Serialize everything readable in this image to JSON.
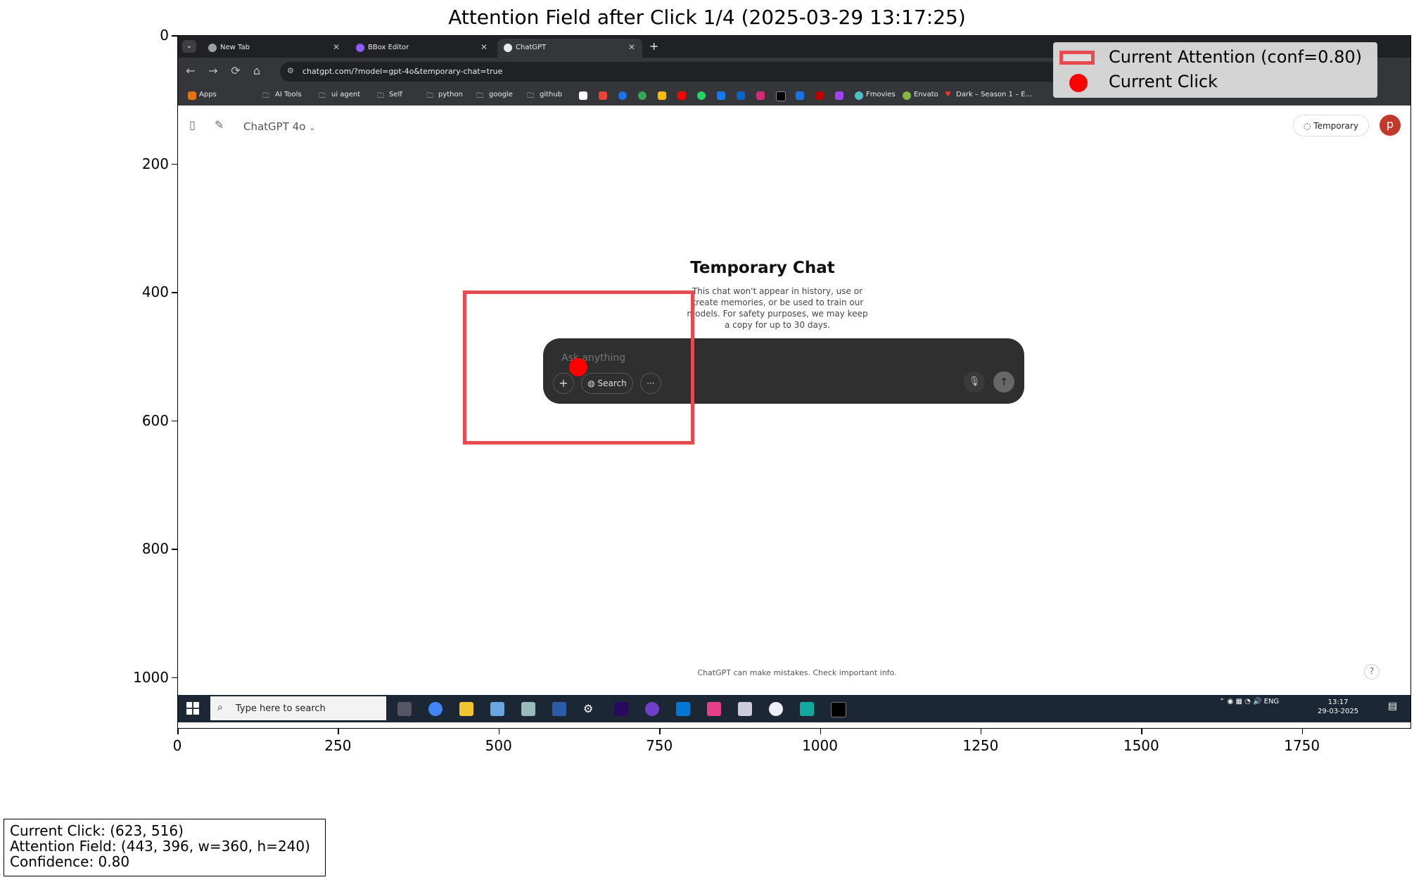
{
  "figure": {
    "title": "Attention Field after Click 1/4 (2025-03-29 13:17:25)",
    "y_ticks": [
      "0",
      "200",
      "400",
      "600",
      "800",
      "1000"
    ],
    "x_ticks": [
      "0",
      "250",
      "500",
      "750",
      "1000",
      "1250",
      "1500",
      "1750"
    ],
    "attention": {
      "x": 443,
      "y": 396,
      "w": 360,
      "h": 240,
      "conf": 0.8
    },
    "click": {
      "x": 623,
      "y": 516
    },
    "colors": {
      "attention": "#e84b4f",
      "click": "#ff0000"
    }
  },
  "legend": {
    "attention_label": "Current Attention (conf=0.80)",
    "click_label": "Current Click"
  },
  "info": {
    "line1": "Current Click: (623, 516)",
    "line2": "Attention Field: (443, 396, w=360, h=240)",
    "line3": "Confidence: 0.80"
  },
  "browser": {
    "tabs": [
      {
        "label": "New Tab",
        "active": false
      },
      {
        "label": "BBox Editor",
        "active": false
      },
      {
        "label": "ChatGPT",
        "active": true
      }
    ],
    "new_tab": "+",
    "url": "chatgpt.com/?model=gpt-4o&temporary-chat=true",
    "bookmarks": [
      "Apps",
      "AI Tools",
      "ui agent",
      "Self",
      "python",
      "google",
      "github",
      "Fmovies",
      "Envato",
      "Dark – Season 1 – E..."
    ]
  },
  "chatgpt": {
    "model": "ChatGPT 4o",
    "temporary_button": "Temporary",
    "avatar": "p",
    "heading": "Temporary Chat",
    "description": "This chat won't appear in history, use or create memories, or be used to train our models. For safety purposes, we may keep a copy for up to 30 days.",
    "input_placeholder": "Ask anything",
    "search_button": "Search",
    "footer": "ChatGPT can make mistakes. Check important info.",
    "help": "?"
  },
  "taskbar": {
    "search_placeholder": "Type here to search",
    "tray_lang": "ENG",
    "time": "13:17",
    "date": "29-03-2025"
  }
}
